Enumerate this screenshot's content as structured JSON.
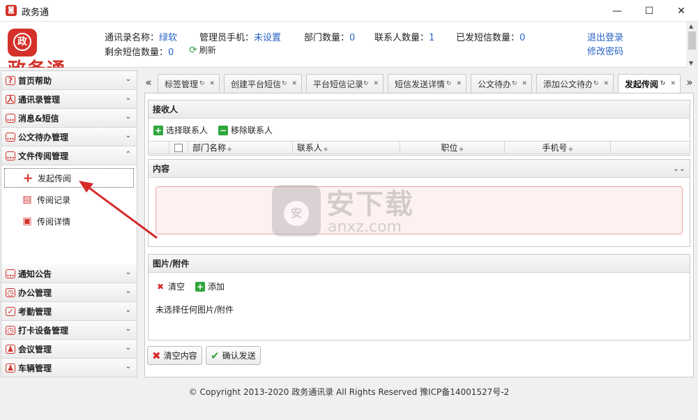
{
  "window": {
    "title": "政务通",
    "icon": "app-logo-icon",
    "minimize": "—",
    "maximize": "☐",
    "close": "✕"
  },
  "header": {
    "logo_text": "政务通",
    "logo_mark": "政",
    "book_name_label": "通讯录名称：",
    "book_name_value": "绿软",
    "admin_phone_label": "管理员手机：",
    "admin_phone_value": "未设置",
    "dept_count_label": "部门数量：",
    "dept_count_value": "0",
    "contact_count_label": "联系人数量：",
    "contact_count_value": "1",
    "sent_sms_label": "已发短信数量：",
    "sent_sms_value": "0",
    "remaining_sms_label": "剩余短信数量：",
    "remaining_sms_value": "0",
    "refresh_label": "刷新",
    "logout_link": "退出登录",
    "change_password_link": "修改密码"
  },
  "sidebar": {
    "sections_top": [
      {
        "label": "首页帮助",
        "icon": "help-icon",
        "glyph": "?"
      },
      {
        "label": "通讯录管理",
        "icon": "contacts-icon",
        "glyph": "人"
      },
      {
        "label": "消息&短信",
        "icon": "message-icon",
        "glyph": "…"
      },
      {
        "label": "公文待办管理",
        "icon": "document-todo-icon",
        "glyph": "…"
      },
      {
        "label": "文件传阅管理",
        "icon": "file-circulation-icon",
        "glyph": "…"
      }
    ],
    "sub_items": [
      {
        "label": "发起传阅",
        "icon": "plus-icon",
        "glyph": "+"
      },
      {
        "label": "传阅记录",
        "icon": "record-icon",
        "glyph": "▤"
      },
      {
        "label": "传阅详情",
        "icon": "detail-icon",
        "glyph": "▣"
      }
    ],
    "sections_bottom": [
      {
        "label": "通知公告",
        "icon": "notice-icon",
        "glyph": "…"
      },
      {
        "label": "办公管理",
        "icon": "office-icon",
        "glyph": "◷"
      },
      {
        "label": "考勤管理",
        "icon": "attendance-icon",
        "glyph": "✓"
      },
      {
        "label": "打卡设备管理",
        "icon": "clock-device-icon",
        "glyph": "◷"
      },
      {
        "label": "会议管理",
        "icon": "meeting-icon",
        "glyph": "♟"
      },
      {
        "label": "车辆管理",
        "icon": "vehicle-icon",
        "glyph": "♟"
      }
    ]
  },
  "tabs": {
    "prev": "«",
    "next": "»",
    "items": [
      {
        "label": "标签管理"
      },
      {
        "label": "创建平台短信"
      },
      {
        "label": "平台短信记录"
      },
      {
        "label": "短信发送详情"
      },
      {
        "label": "公文待办"
      },
      {
        "label": "添加公文待办"
      },
      {
        "label": "发起传阅",
        "active": true
      }
    ],
    "tab_controls": "↻ ✕"
  },
  "recipients": {
    "title": "接收人",
    "select_contacts": "选择联系人",
    "remove_contacts": "移除联系人",
    "columns": [
      "部门名称",
      "联系人",
      "职位",
      "手机号"
    ]
  },
  "content": {
    "title": "内容",
    "collapse": "⌄⌄"
  },
  "attachments": {
    "title": "图片/附件",
    "clear": "清空",
    "add": "添加",
    "empty_text": "未选择任何图片/附件"
  },
  "actions": {
    "clear_content": "清空内容",
    "confirm_send": "确认发送"
  },
  "footer": {
    "copyright": "© Copyright 2013-2020 政务通讯录 All Rights Reserved    豫ICP备14001527号-2"
  },
  "watermark": {
    "mark": "安",
    "text_big": "安下载",
    "text_small": "anxz.com"
  },
  "colors": {
    "brand": "#d4312a",
    "link": "#2a64c5",
    "green": "#2fa63c",
    "arrow": "#d62a2a"
  }
}
